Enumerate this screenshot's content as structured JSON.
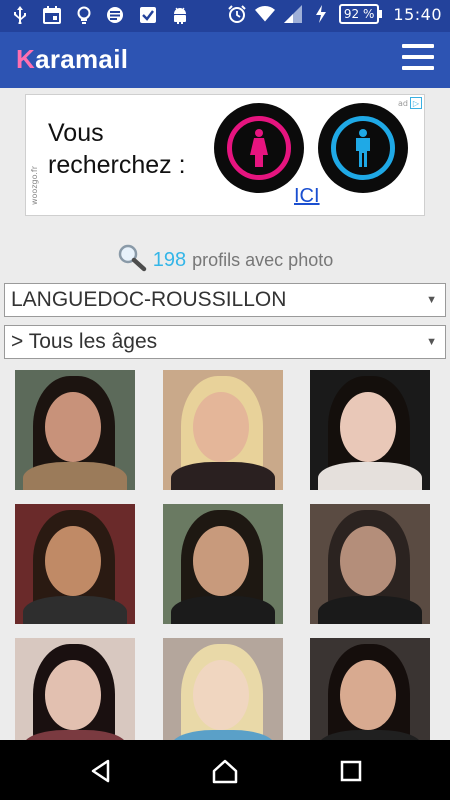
{
  "status_bar": {
    "time": "15:40",
    "battery": "92 %",
    "icons_left": [
      "usb-icon",
      "calendar-icon",
      "lightbulb-icon",
      "news-icon",
      "checklist-icon",
      "android-icon"
    ],
    "icons_right": [
      "alarm-icon",
      "wifi-icon",
      "signal-icon",
      "charging-icon"
    ]
  },
  "app": {
    "brand_first": "K",
    "brand_rest": "aramail",
    "accent": "#ff6fb0",
    "bar_color": "#2d54b3"
  },
  "ad": {
    "line1": "Vous",
    "line2": "recherchez :",
    "link": "ICI",
    "side_text": "woozgo.fr"
  },
  "profiles": {
    "count": "198",
    "label": "profils avec photo"
  },
  "filters": {
    "region": "LANGUEDOC-ROUSSILLON",
    "age": "> Tous les âges"
  },
  "photos": [
    {
      "bg": "#5c6a5a",
      "hair": "#1c1410",
      "face": "#c8927a",
      "body": "#9b7b5a"
    },
    {
      "bg": "#c9a98a",
      "hair": "#e8d29a",
      "face": "#e4b699",
      "body": "#2a2020"
    },
    {
      "bg": "#1a1a1a",
      "hair": "#140f0c",
      "face": "#e9c8b8",
      "body": "#e5e0dc"
    },
    {
      "bg": "#6a2a2a",
      "hair": "#2a1a12",
      "face": "#c08a66",
      "body": "#2e2e2e"
    },
    {
      "bg": "#6a7a62",
      "hair": "#1e1812",
      "face": "#c89a7c",
      "body": "#1b1b1b"
    },
    {
      "bg": "#5a4b42",
      "hair": "#2b2320",
      "face": "#b48e7a",
      "body": "#1a1a1a"
    },
    {
      "bg": "#d8c8c0",
      "hair": "#1a1010",
      "face": "#e2c0b0",
      "body": "#7a3a40"
    },
    {
      "bg": "#b4a69c",
      "hair": "#e9d9a8",
      "face": "#f0d6c0",
      "body": "#5aa0c8"
    },
    {
      "bg": "#3a3432",
      "hair": "#150e0c",
      "face": "#d8aa90",
      "body": "#202020"
    }
  ]
}
